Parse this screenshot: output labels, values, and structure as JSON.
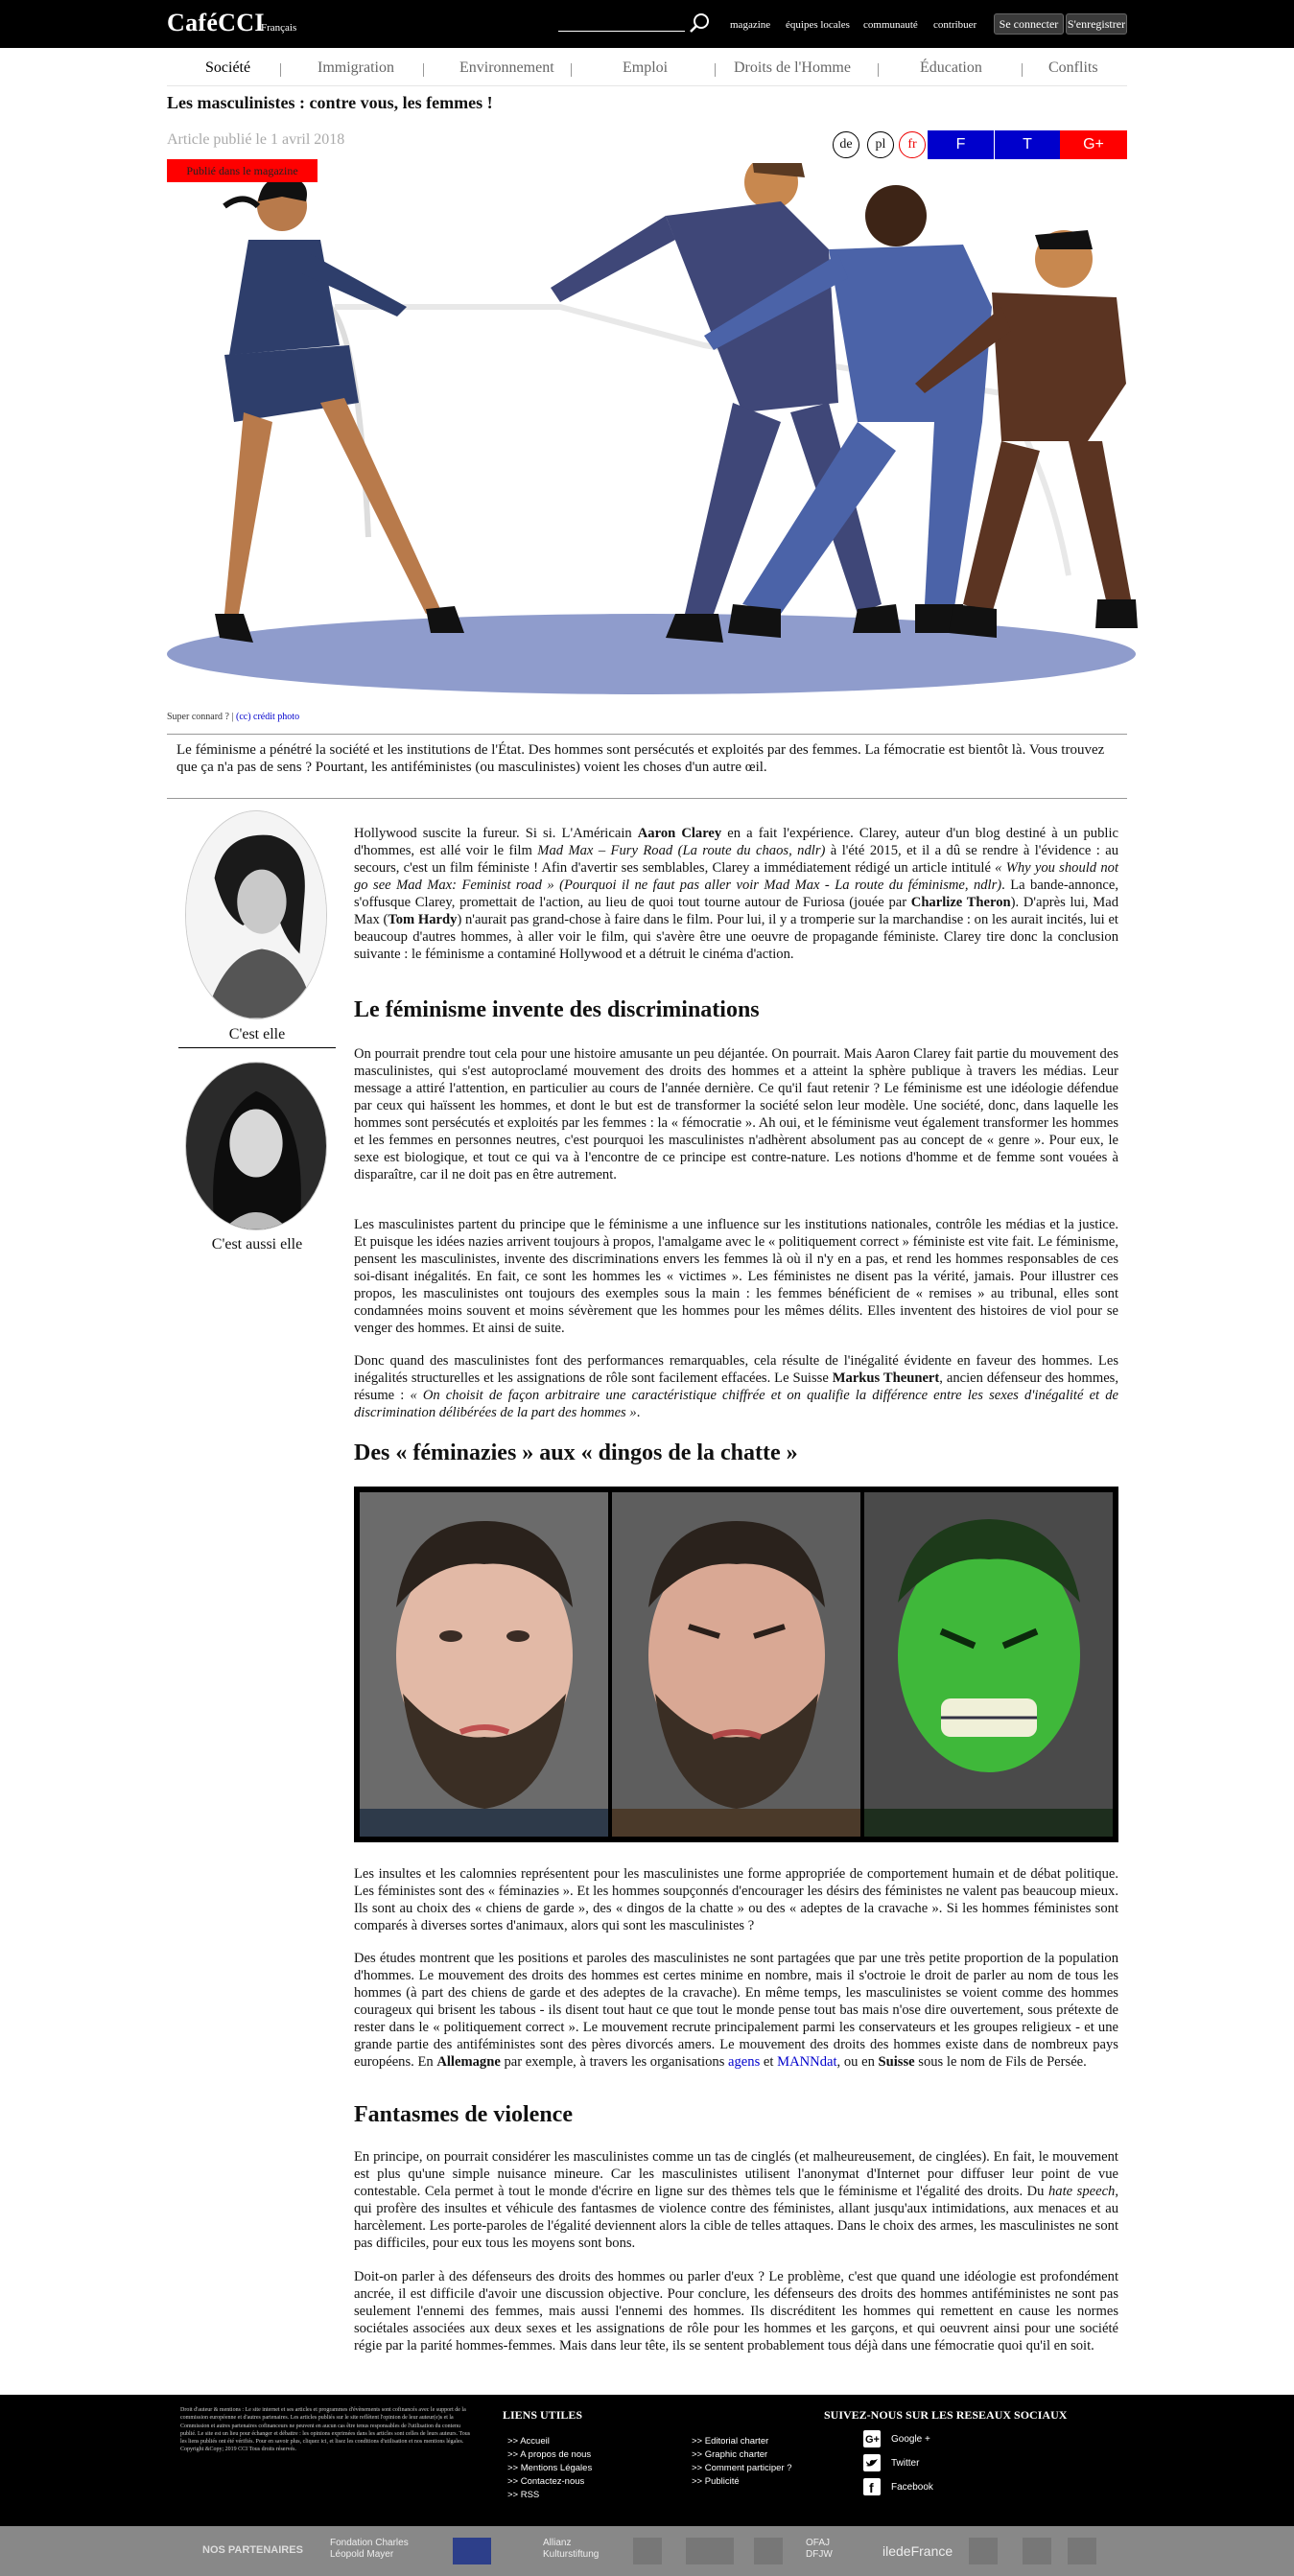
{
  "site": {
    "logo": "CaféCCI",
    "logo_sub": "Français"
  },
  "topnav": {
    "links": [
      "magazine",
      "équipes locales",
      "communauté",
      "contribuer"
    ],
    "login": "Se connecter",
    "register": "S'enregistrer"
  },
  "menu": [
    "Société",
    "Immigration",
    "Environnement",
    "Emploi",
    "Droits de l'Homme",
    "Éducation",
    "Conflits"
  ],
  "article": {
    "title": "Les masculinistes : contre vous, les femmes !",
    "date": "Article publié le 1 avril 2018",
    "magazine_button": "Publié dans le magazine",
    "languages": [
      "de",
      "pl",
      "fr"
    ],
    "share": [
      "F",
      "T",
      "G+"
    ],
    "photo_credit_prefix": "Super connard ? | ",
    "photo_credit_link": "(cc) crédit photo",
    "chapo": "Le féminisme a pénétré la société et les institutions de l'État. Des hommes sont persécutés et exploités par des femmes. La fémocratie est bientôt là. Vous trouvez que ça n'a pas de sens ? Pourtant, les antiféministes (ou masculinistes) voient les choses d'un autre œil.",
    "authors": [
      {
        "caption": "C'est elle"
      },
      {
        "caption": "C'est aussi elle"
      }
    ],
    "h2_1": "Le féminisme invente des discriminations",
    "h2_2": "Des « féminazies » aux « dingos de la chatte »",
    "h2_3": "Fantasmes de violence"
  },
  "footer": {
    "legal": "Droit d'auteur & mentions : Le site internet et ses articles et programmes d'évènements sont cofinancés avec le support de la commission européenne et d'autres partenaires. Les articles publiés sur le site reflètent l'opinion de leur auteur(e)s et la Commission et autres partenaires cofinanceurs ne peuvent en aucun cas être tenus responsables de l'utilisation du contenu publié. Le site est un lieu pour échanger et débattre : les opinions exprimées dans les articles sont celles de leurs auteurs. Tous les liens publiés ont été vérifiés. Pour en savoir plus, cliquez ici, et lisez les conditions d'utilisation et nos mentions légales. Copyright &Copy; 2019 CCI Tous droits réservés.",
    "useful_links_title": "LIENS UTILES",
    "links_col1": [
      ">> Accueil",
      ">> A propos de nous",
      ">> Mentions Légales",
      ">> Contactez-nous",
      ">> RSS"
    ],
    "links_col2": [
      ">> Editorial charter",
      ">> Graphic charter",
      ">> Comment participer ?",
      ">> Publicité"
    ],
    "social_title": "SUIVEZ-NOUS SUR LES RESEAUX SOCIAUX",
    "social": [
      "Google +",
      "Twitter",
      "Facebook"
    ],
    "partners_label": "NOS PARTENAIRES",
    "partners": [
      "Fondation Charles Léopold Mayer",
      "Allianz Kulturstiftung",
      "OFAJ DFJW",
      "iledeFrance"
    ]
  }
}
